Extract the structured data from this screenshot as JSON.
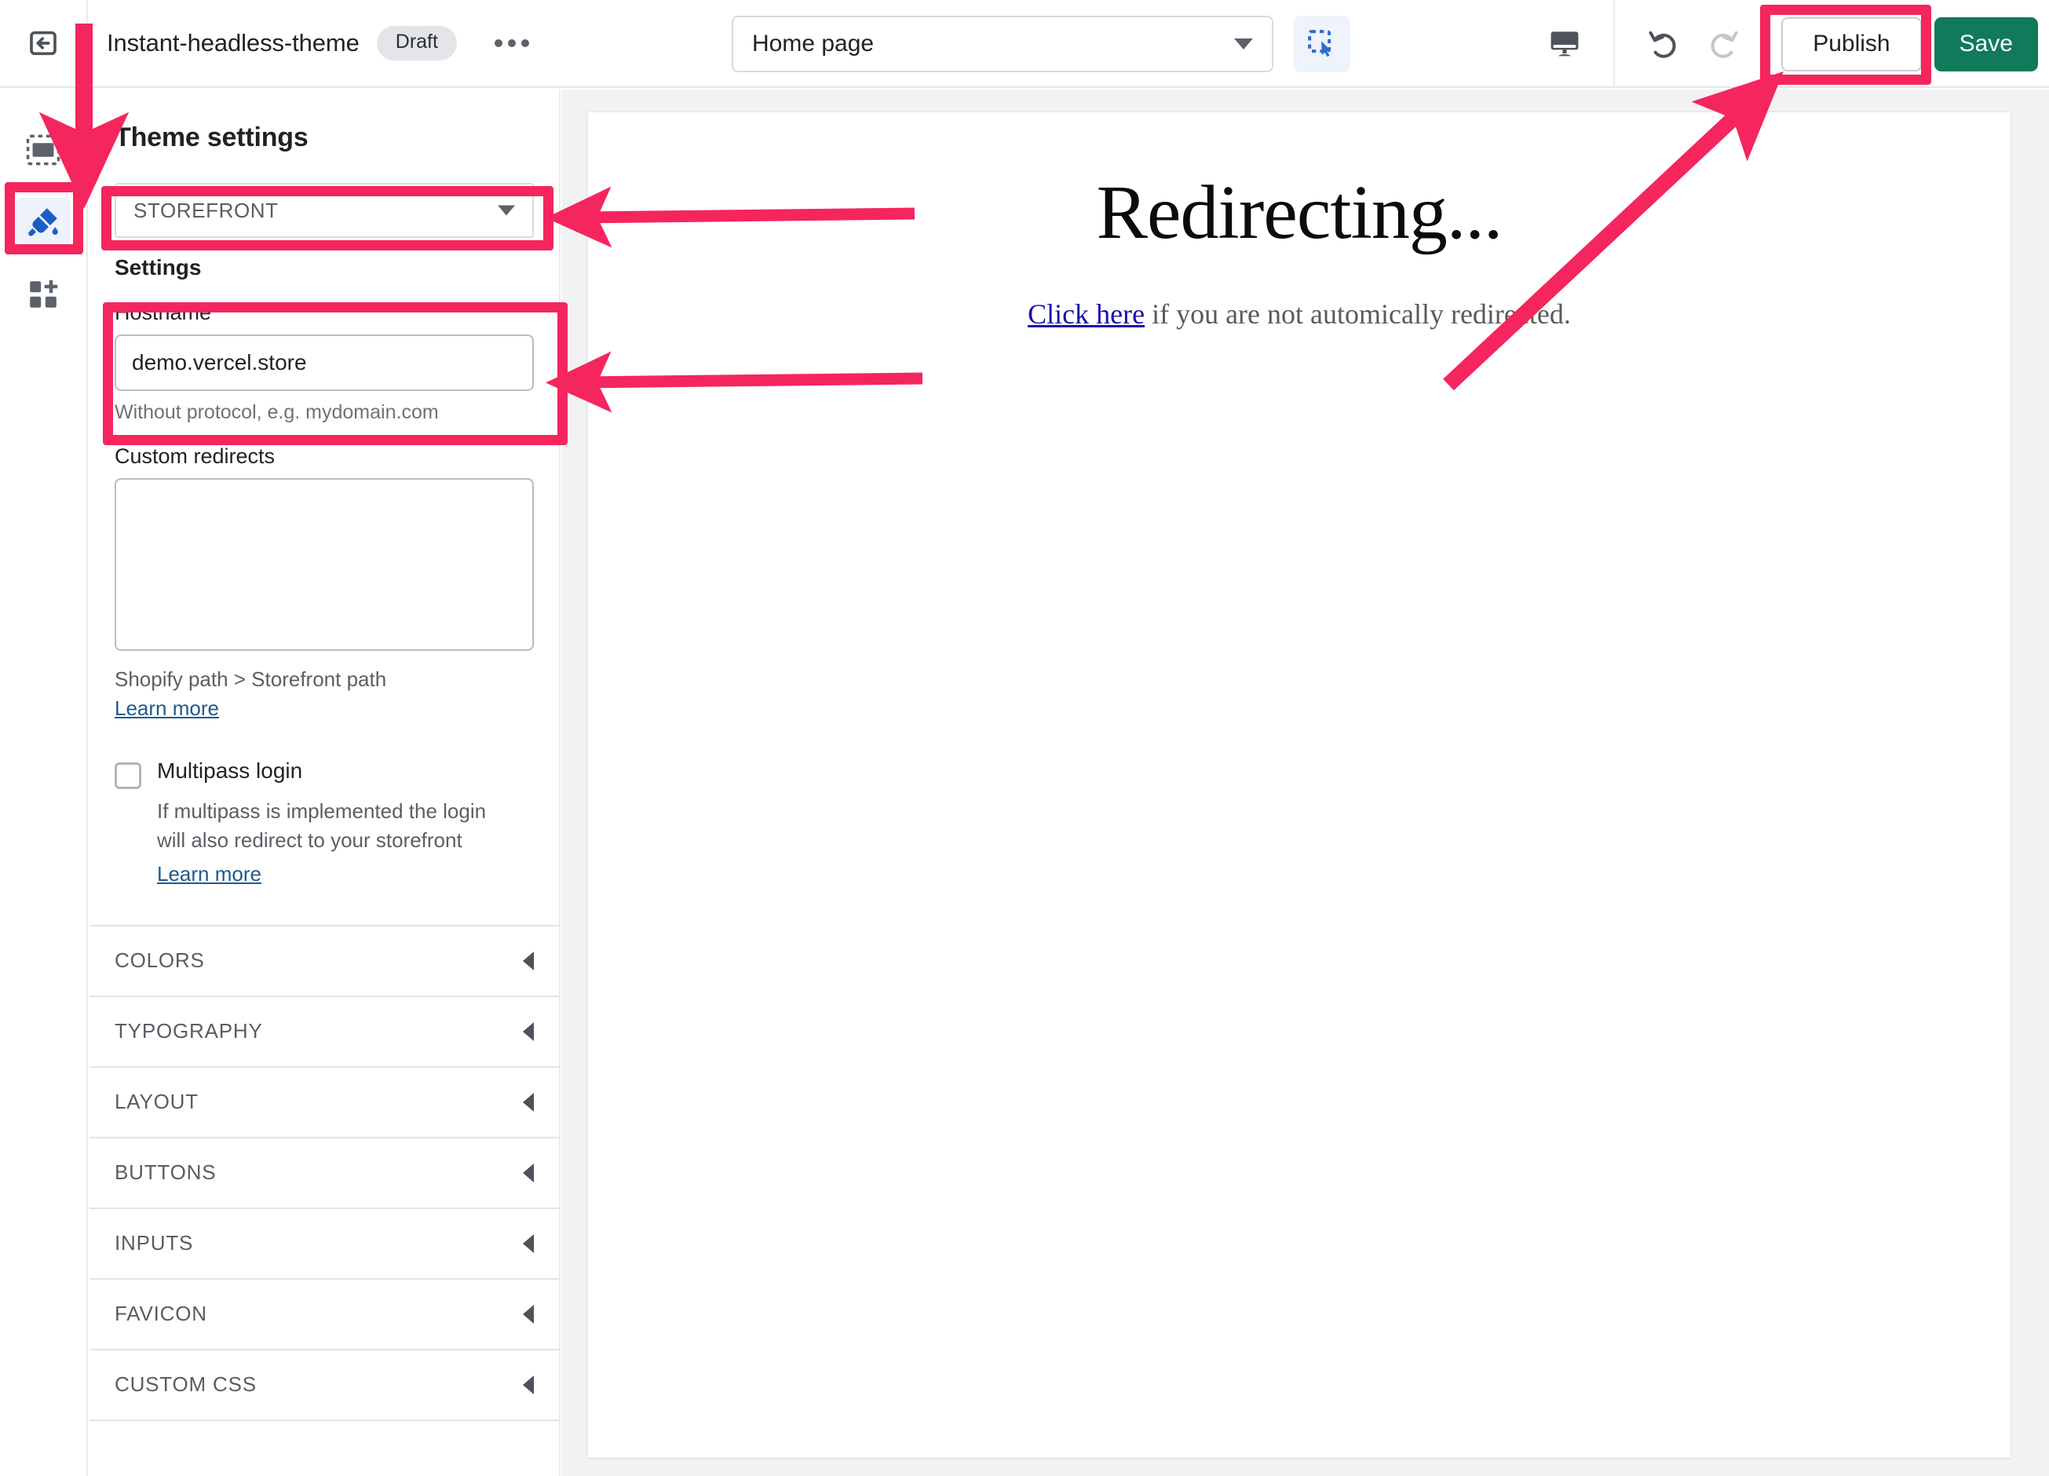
{
  "topbar": {
    "back_icon": "back-arrow-icon",
    "theme_name": "Instant-headless-theme",
    "status_badge": "Draft",
    "more_menu_icon": "ellipsis-icon",
    "page_selector": {
      "value": "Home page",
      "caret_icon": "chevron-down-icon"
    },
    "select_tool_icon": "selection-cursor-icon",
    "device_preview_icon": "desktop-monitor-icon",
    "undo_icon": "undo-arrow-icon",
    "redo_icon": "redo-arrow-icon",
    "publish_label": "Publish",
    "save_label": "Save"
  },
  "rail": {
    "items": [
      {
        "icon": "sections-layout-icon",
        "name": "sections",
        "active": false
      },
      {
        "icon": "paintbrush-icon",
        "name": "theme-settings",
        "active": true
      },
      {
        "icon": "apps-grid-plus-icon",
        "name": "apps",
        "active": false
      }
    ]
  },
  "panel": {
    "title": "Theme settings",
    "group_select": {
      "value": "STOREFRONT",
      "caret_icon": "chevron-down-icon"
    },
    "settings_heading": "Settings",
    "hostname": {
      "label": "Hostname",
      "value": "demo.vercel.store",
      "placeholder": "mydomain.com",
      "help": "Without protocol, e.g. mydomain.com"
    },
    "custom_redirects": {
      "label": "Custom redirects",
      "value": "",
      "placeholder": "",
      "help": "Shopify path > Storefront path",
      "link": "Learn more"
    },
    "multipass": {
      "label": "Multipass login",
      "checked": false,
      "help": "If multipass is implemented the login will also redirect to your storefront",
      "link": "Learn more"
    },
    "accordions": [
      {
        "title": "COLORS",
        "caret_icon": "chevron-left-icon"
      },
      {
        "title": "TYPOGRAPHY",
        "caret_icon": "chevron-left-icon"
      },
      {
        "title": "LAYOUT",
        "caret_icon": "chevron-left-icon"
      },
      {
        "title": "BUTTONS",
        "caret_icon": "chevron-left-icon"
      },
      {
        "title": "INPUTS",
        "caret_icon": "chevron-left-icon"
      },
      {
        "title": "FAVICON",
        "caret_icon": "chevron-left-icon"
      },
      {
        "title": "CUSTOM CSS",
        "caret_icon": "chevron-left-icon"
      }
    ]
  },
  "preview": {
    "heading": "Redirecting...",
    "link_text": "Click here",
    "sub_text": " if you are not automically redirected."
  },
  "annotation_color": "#F5255E"
}
